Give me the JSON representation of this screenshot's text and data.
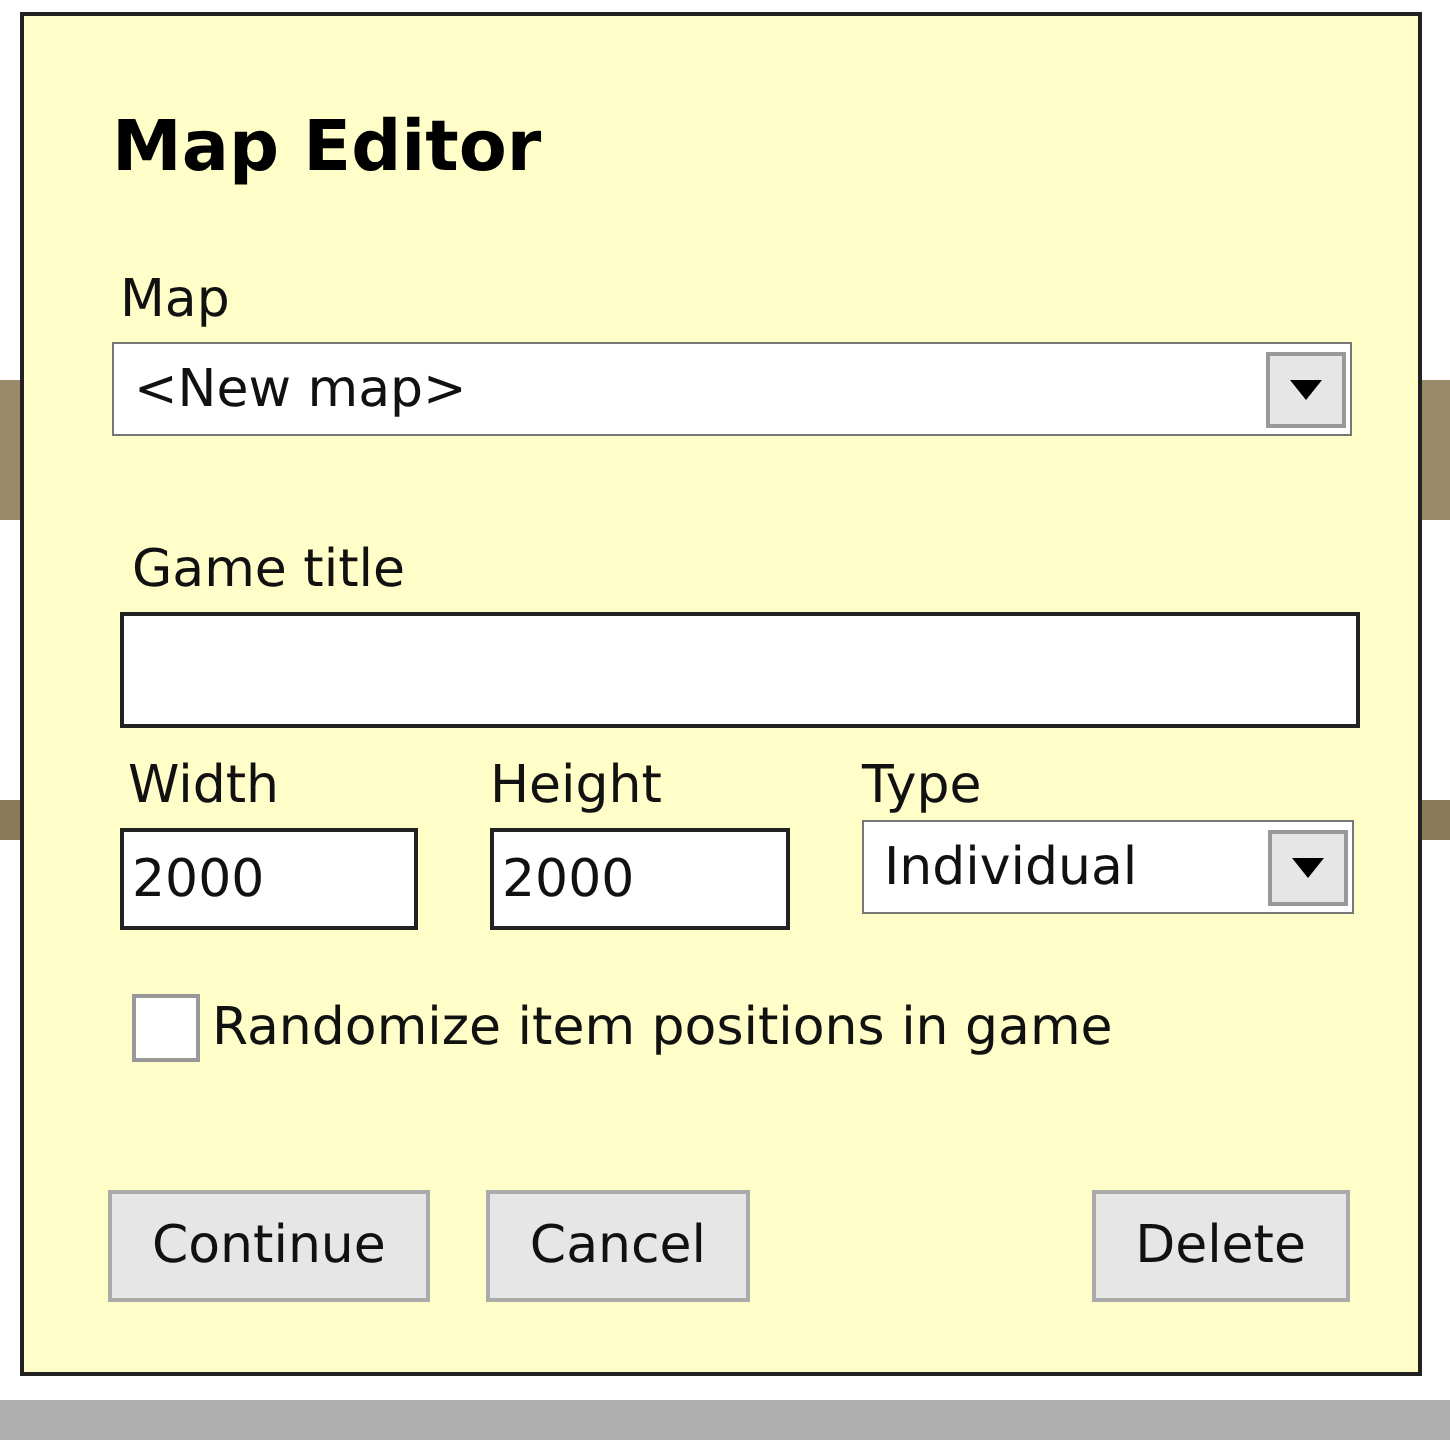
{
  "dialog": {
    "title": "Map Editor",
    "map": {
      "label": "Map",
      "value": "<New map>"
    },
    "game_title": {
      "label": "Game title"
    },
    "width": {
      "label": "Width",
      "value": "2000"
    },
    "height": {
      "label": "Height",
      "value": "2000"
    },
    "type": {
      "label": "Type",
      "value": "Individual"
    },
    "randomize": {
      "label": "Randomize item positions in game",
      "checked": false
    },
    "buttons": [
      {
        "label": "Continue",
        "kind": "left"
      },
      {
        "label": "Cancel",
        "kind": "left"
      },
      {
        "label": "Delete",
        "kind": "right"
      }
    ]
  }
}
